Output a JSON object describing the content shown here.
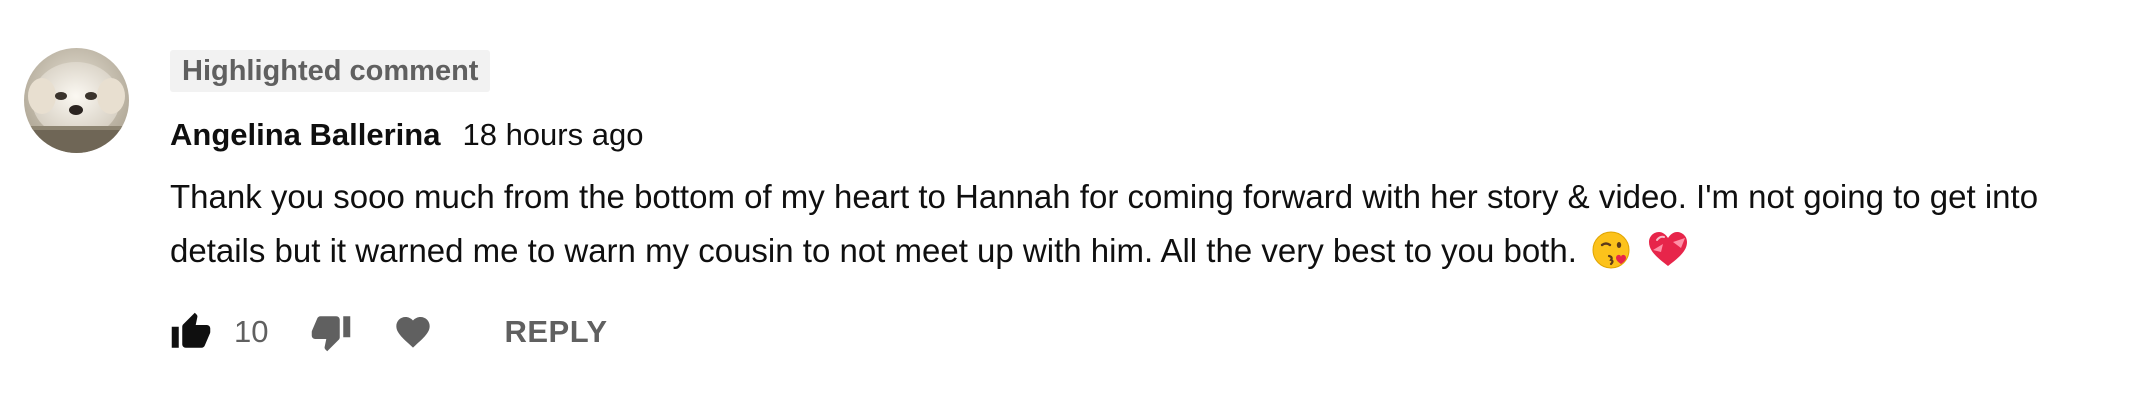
{
  "comment": {
    "badge": "Highlighted comment",
    "author": "Angelina Ballerina",
    "timestamp": "18 hours ago",
    "text": "Thank you sooo much from the bottom of my heart to Hannah for coming forward with her story & video. I'm not going to get into details but it warned me to warn my cousin to not meet up with him. All the very best to you both.",
    "emojis": [
      "face-blowing-a-kiss-icon",
      "heart-with-ribbon-icon"
    ],
    "like_count": "10",
    "reply_label": "REPLY"
  },
  "icons": {
    "like": "thumbs-up-icon",
    "dislike": "thumbs-down-icon",
    "heart": "heart-icon"
  },
  "colors": {
    "text_primary": "#0f0f0f",
    "text_secondary": "#606060",
    "badge_bg": "#f2f2f2"
  }
}
